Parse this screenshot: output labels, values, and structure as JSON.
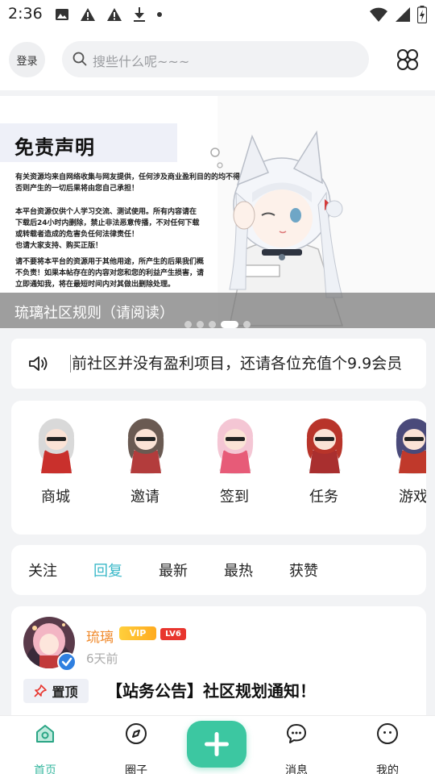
{
  "status_bar": {
    "time": "2:36",
    "left_icons": [
      "image-icon",
      "warning-icon",
      "warning-icon",
      "download-icon",
      "dot-icon"
    ],
    "right_icons": [
      "wifi-icon",
      "signal-icon",
      "battery-icon"
    ]
  },
  "header": {
    "login_label": "登录",
    "search_placeholder": "搜些什么呢~~~",
    "grid_icon": "grid-icon"
  },
  "banner": {
    "title": "免责声明",
    "paragraphs": [
      [
        "有关资源均来自网络收集与网友提供，任何涉及商业盈利目的的均不得使用，",
        "否则产生的一切后果将由您自己承担！"
      ],
      [
        "本平台资源仅供个人学习交流、测试使用。所有内容请在",
        "下载后24小时内删除，禁止非法恶意传播，不对任何下载",
        "或转载者造成的危害负任何法律责任！",
        "也请大家支持、购买正版！"
      ],
      [
        "请不要将本平台的资源用于其他用途，所产生的后果我们概",
        "不负责！如果本帖存在的内容对您和您的利益产生损害，请",
        "立即通知我，将在最短时间内对其做出删除处理。"
      ]
    ],
    "caption": "琉璃社区规则（请阅读）",
    "dots": 5,
    "active_dot": 3
  },
  "notice": {
    "icon": "speaker-icon",
    "text": "前社区并没有盈利项目，还请各位充值个9.9会员"
  },
  "quick_menu": [
    {
      "label": "商城",
      "hair": "#d9d9d9",
      "cloth": "#c9302c"
    },
    {
      "label": "邀请",
      "hair": "#6a5a52",
      "cloth": "#b33c3c"
    },
    {
      "label": "签到",
      "hair": "#f4c6d4",
      "cloth": "#e75b78"
    },
    {
      "label": "任务",
      "hair": "#b8342a",
      "cloth": "#a92f2f"
    },
    {
      "label": "游戏",
      "hair": "#4a4a7a",
      "cloth": "#c0392b"
    }
  ],
  "tabs": [
    {
      "label": "关注",
      "active": false
    },
    {
      "label": "回复",
      "active": true
    },
    {
      "label": "最新",
      "active": false
    },
    {
      "label": "最热",
      "active": false
    },
    {
      "label": "获赞",
      "active": false
    }
  ],
  "post": {
    "author": "琉璃",
    "vip_badge": "VIP",
    "level": "LV6",
    "time": "6天前",
    "pin_label": "置顶",
    "title": "【站务公告】社区规划通知！"
  },
  "bottom_nav": [
    {
      "label": "首页",
      "icon": "home-icon",
      "active": true
    },
    {
      "label": "圈子",
      "icon": "compass-icon",
      "active": false
    },
    {
      "label": "消息",
      "icon": "message-icon",
      "active": false
    },
    {
      "label": "我的",
      "icon": "profile-icon",
      "active": false
    }
  ],
  "colors": {
    "accent": "#3cc7a1",
    "tab_active": "#3ab8c8",
    "username": "#f08a2c",
    "level_badge": "#e8352e"
  }
}
